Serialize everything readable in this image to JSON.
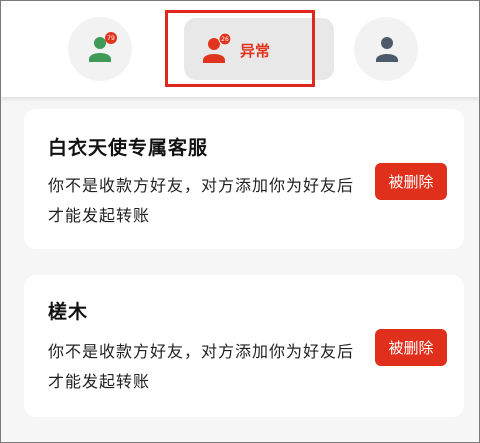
{
  "tabs": [
    {
      "name": "normal",
      "badge": "79",
      "color": "#3f9a55"
    },
    {
      "name": "abnormal",
      "badge": "26",
      "label": "异常",
      "color": "#e1341e"
    },
    {
      "name": "contact",
      "color": "#4d5a6a"
    }
  ],
  "items": [
    {
      "title": "白衣天使专属客服",
      "message": "你不是收款方好友，对方添加你为好友后才能发起转账",
      "status": "被删除"
    },
    {
      "title": "槎木",
      "message": "你不是收款方好友，对方添加你为好友后才能发起转账",
      "status": "被删除"
    }
  ]
}
